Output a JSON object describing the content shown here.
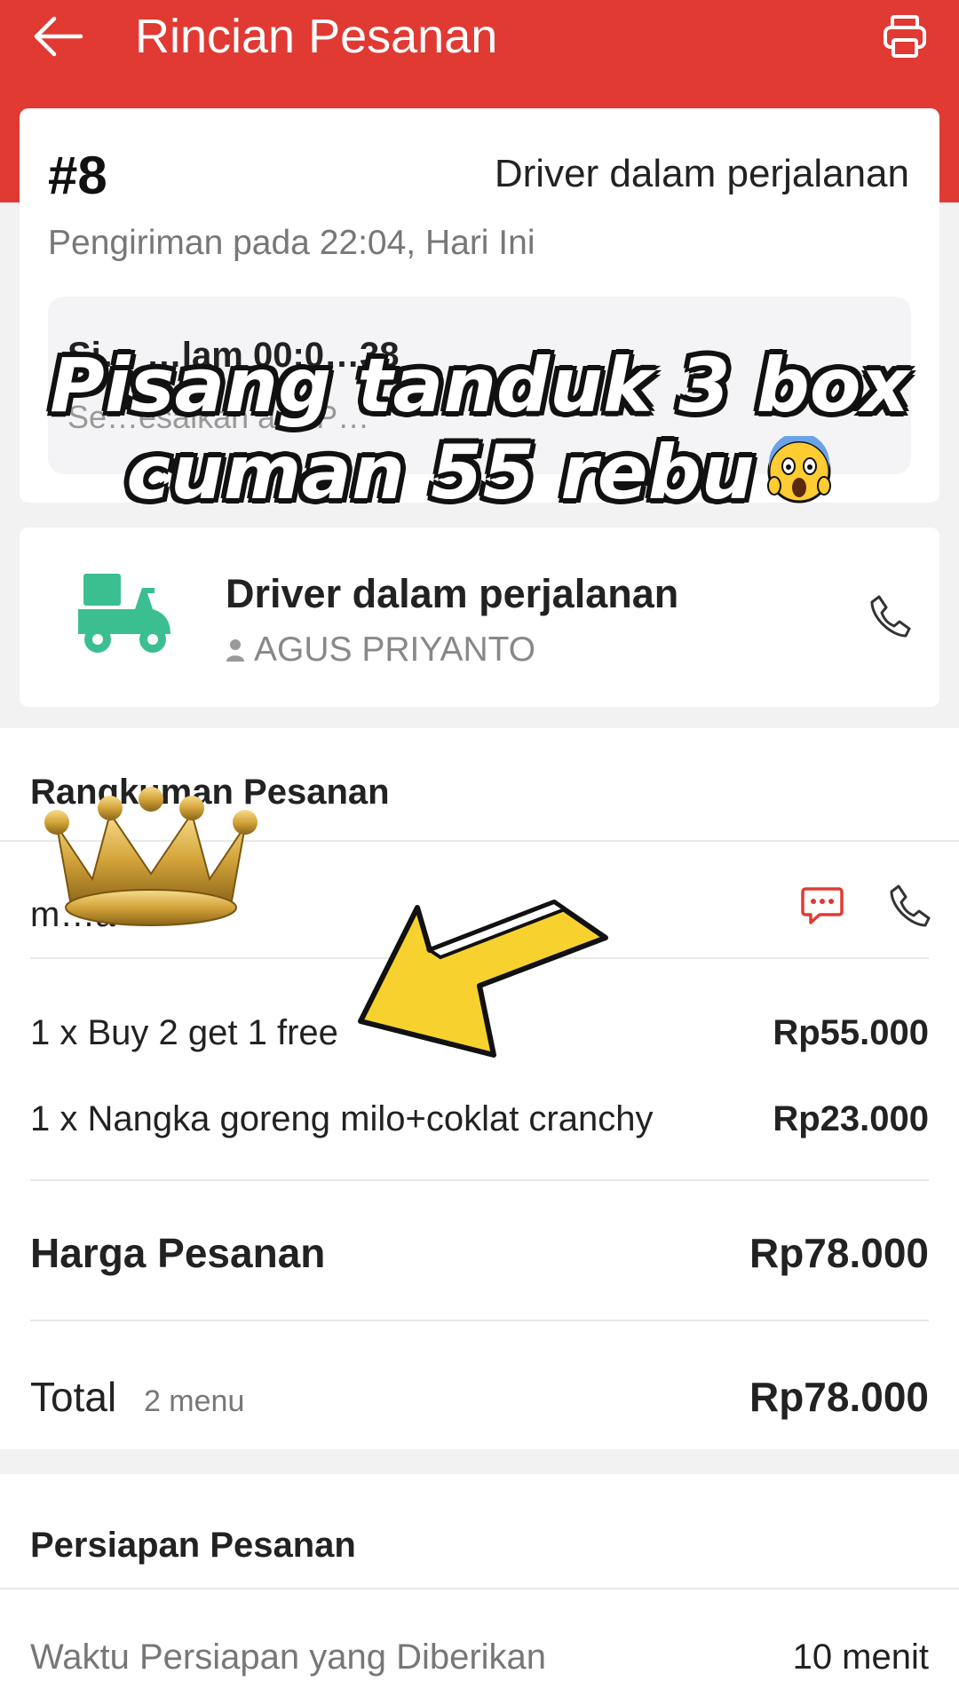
{
  "header": {
    "title": "Rincian Pesanan",
    "bg_color": "#e03a33"
  },
  "order": {
    "number": "#8",
    "status": "Driver dalam perjalanan",
    "shipping": "Pengiriman pada 22:04, Hari Ini",
    "inner_line1": "Si… …lam 00:0…38",
    "inner_line2": "Se…esaikan a… P…"
  },
  "overlay": {
    "line1": "Pisang tanduk 3 box",
    "line2": "cuman 55 rebu"
  },
  "driver": {
    "status": "Driver dalam perjalanan",
    "name": "AGUS PRIYANTO",
    "icon_color": "#3bbf91"
  },
  "summary": {
    "title": "Rangkuman Pesanan",
    "customer": "m…a",
    "items": [
      {
        "label": "1 x Buy 2 get 1 free",
        "price": "Rp55.000"
      },
      {
        "label": "1 x Nangka goreng milo+coklat cranchy",
        "price": "Rp23.000"
      }
    ],
    "harga_label": "Harga Pesanan",
    "harga_value": "Rp78.000",
    "total_label": "Total",
    "total_count": "2 menu",
    "total_value": "Rp78.000"
  },
  "prep": {
    "title": "Persiapan Pesanan",
    "label": "Waktu Persiapan yang Diberikan",
    "value": "10 menit"
  }
}
